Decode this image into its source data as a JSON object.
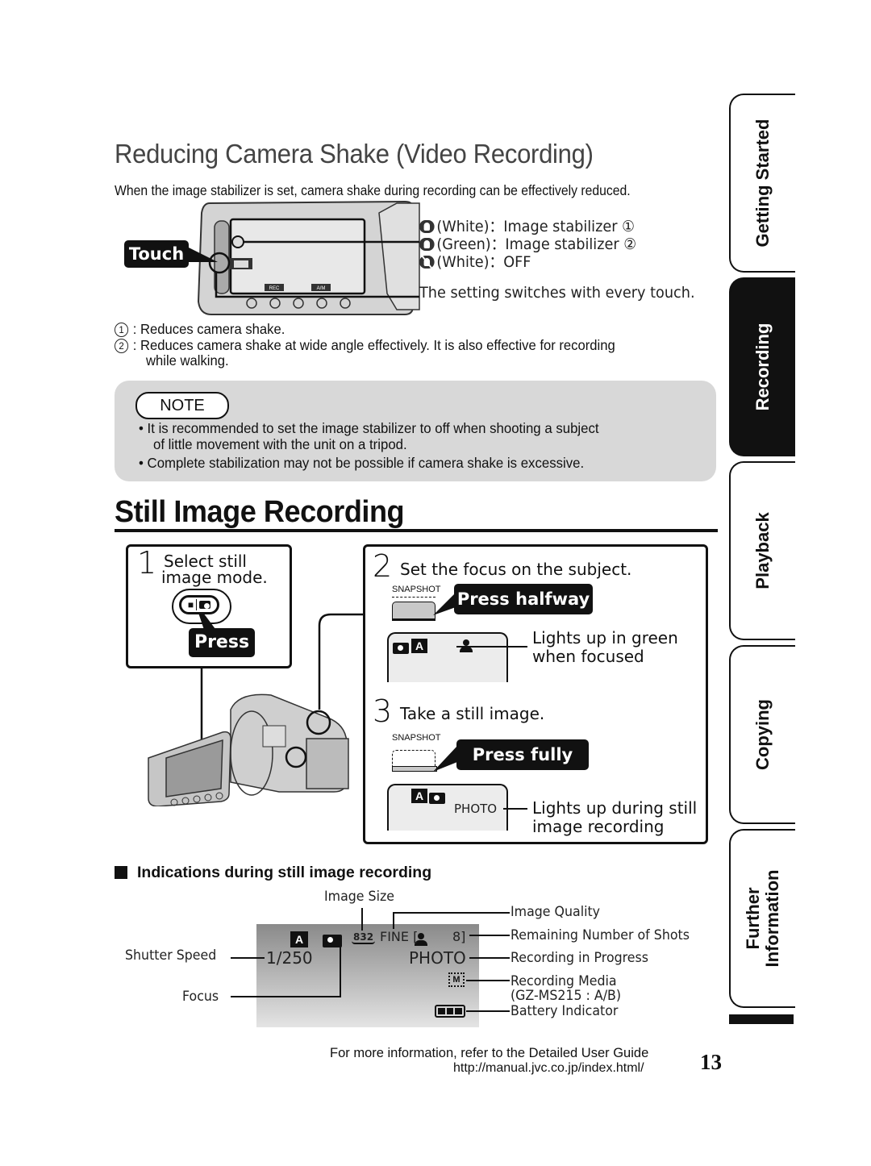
{
  "section1": {
    "title": "Reducing Camera Shake (Video Recording)",
    "intro": "When the image stabilizer is set, camera shake during recording can be effectively reduced.",
    "touch_label": "Touch",
    "lcd_buttons": [
      "REC",
      "A/M"
    ],
    "legend": [
      {
        "icon": "stabilizer-on-icon",
        "text": "(White)：Image stabilizer ①"
      },
      {
        "icon": "stabilizer-on-icon",
        "text": "(Green)：Image stabilizer ②"
      },
      {
        "icon": "stabilizer-off-icon",
        "text": "(White)：OFF"
      }
    ],
    "switch_note": "The setting switches with every touch.",
    "footnotes": [
      {
        "num": "1",
        "text": "Reduces camera shake."
      },
      {
        "num": "2",
        "text": "Reduces camera shake at wide angle effectively. It is also effective for recording",
        "cont": "while walking."
      }
    ],
    "note": {
      "tag": "NOTE",
      "items": [
        {
          "line1": "It is recommended to set the image stabilizer to off when shooting a subject",
          "line2": "of little movement with the unit on a tripod."
        },
        {
          "line1": "Complete stabilization may not be possible if camera shake is excessive."
        }
      ]
    }
  },
  "section2": {
    "title": "Still Image Recording",
    "step1": {
      "num": "1",
      "line1": "Select still",
      "line2": "image mode.",
      "callout": "Press"
    },
    "step2": {
      "num": "2",
      "text": "Set the focus on the subject.",
      "button_label": "SNAPSHOT",
      "callout": "Press halfway",
      "desc1": "Lights up in green",
      "desc2": "when focused"
    },
    "step3": {
      "num": "3",
      "text": "Take a still image.",
      "button_label": "SNAPSHOT",
      "callout": "Press fully",
      "lcd_photo": "PHOTO",
      "desc1": "Lights up during still",
      "desc2": "image recording"
    }
  },
  "indications": {
    "heading": "Indications during still image recording",
    "lcd": {
      "image_size": "832",
      "quality": "FINE [",
      "shots": "8]",
      "shutter": "1/250",
      "photo": "PHOTO",
      "media": "M"
    },
    "labels": {
      "image_size": "Image Size",
      "image_quality": "Image Quality",
      "remaining": "Remaining Number of Shots",
      "recording": "Recording in Progress",
      "media": "Recording Media",
      "media_models": "(GZ-MS215 : A/B)",
      "battery": "Battery Indicator",
      "shutter": "Shutter Speed",
      "focus": "Focus"
    }
  },
  "side_tabs": [
    {
      "label": "Getting Started",
      "active": false
    },
    {
      "label": "Recording",
      "active": true
    },
    {
      "label": "Playback",
      "active": false
    },
    {
      "label": "Copying",
      "active": false
    },
    {
      "label": "Further\nInformation",
      "active": false
    }
  ],
  "footer": {
    "line1": "For more information, refer to the Detailed User Guide",
    "line2": "http://manual.jvc.co.jp/index.html/",
    "page_number": "13"
  }
}
